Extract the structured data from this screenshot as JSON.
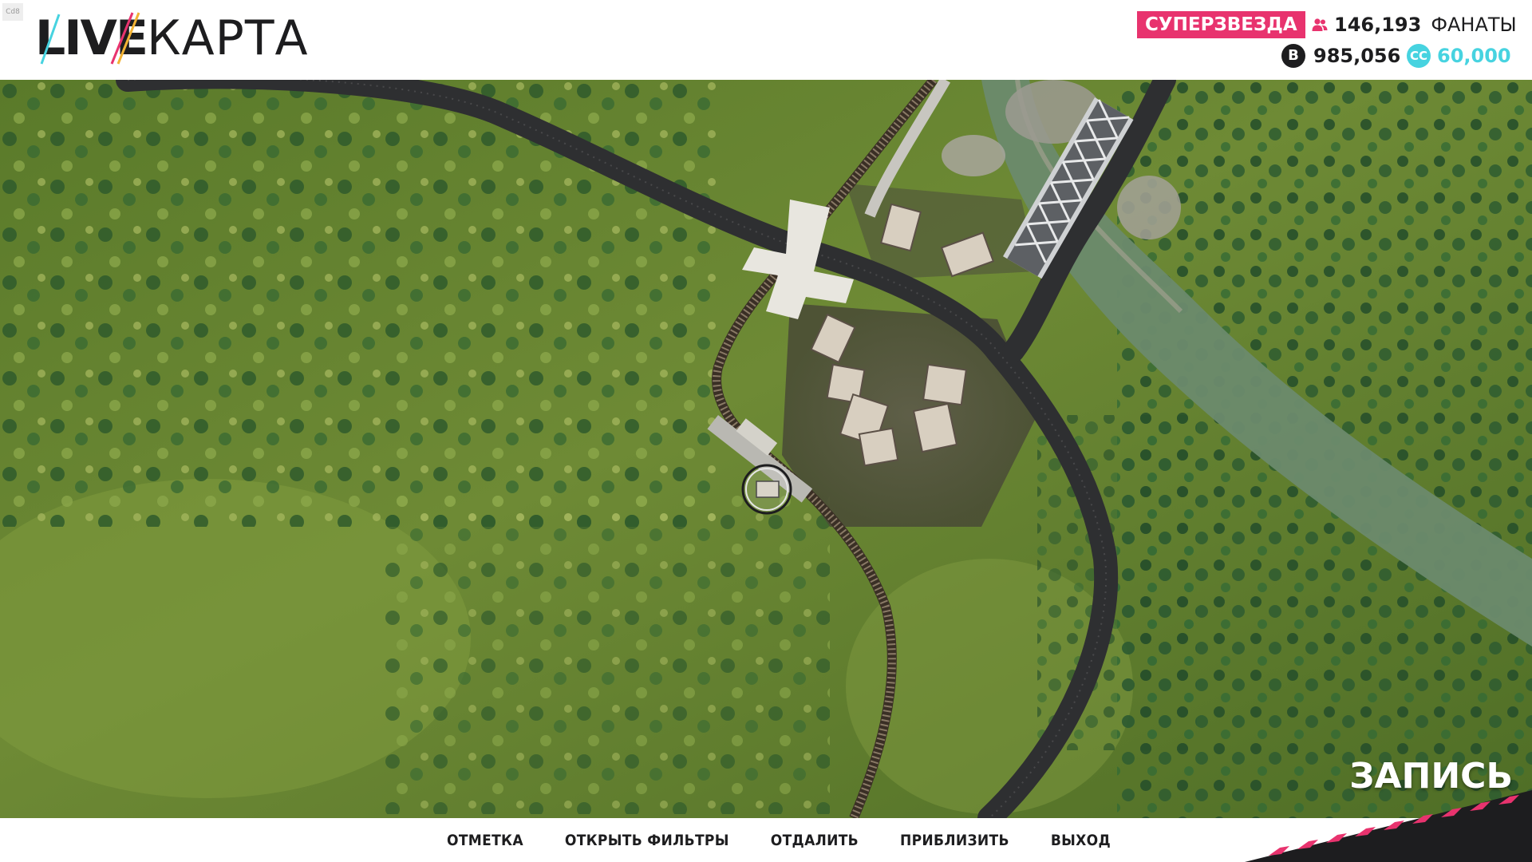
{
  "build_tag": "Cd8",
  "logo": {
    "live": "LIVE",
    "map": "КАРТА"
  },
  "status": {
    "rank": "СУПЕРЗВЕЗДА",
    "fans_count": "146,193",
    "fans_label": "ФАНАТЫ",
    "money_icon": "B",
    "money": "985,056",
    "cc_icon": "CC",
    "cc": "60,000"
  },
  "colors": {
    "accent_pink": "#e8336e",
    "cc_cyan": "#47d3e0",
    "text_dark": "#1d1d1f"
  },
  "actions": [
    "ОТМЕТКА",
    "ОТКРЫТЬ ФИЛЬТРЫ",
    "ОТДАЛИТЬ",
    "ПРИБЛИЗИТЬ",
    "ВЫХОД"
  ],
  "record_label": "ЗАПИСЬ",
  "icons": {
    "fans": "people-icon",
    "money": "bits-coin-icon",
    "cc": "cc-coin-icon",
    "player": "player-marker-icon"
  }
}
